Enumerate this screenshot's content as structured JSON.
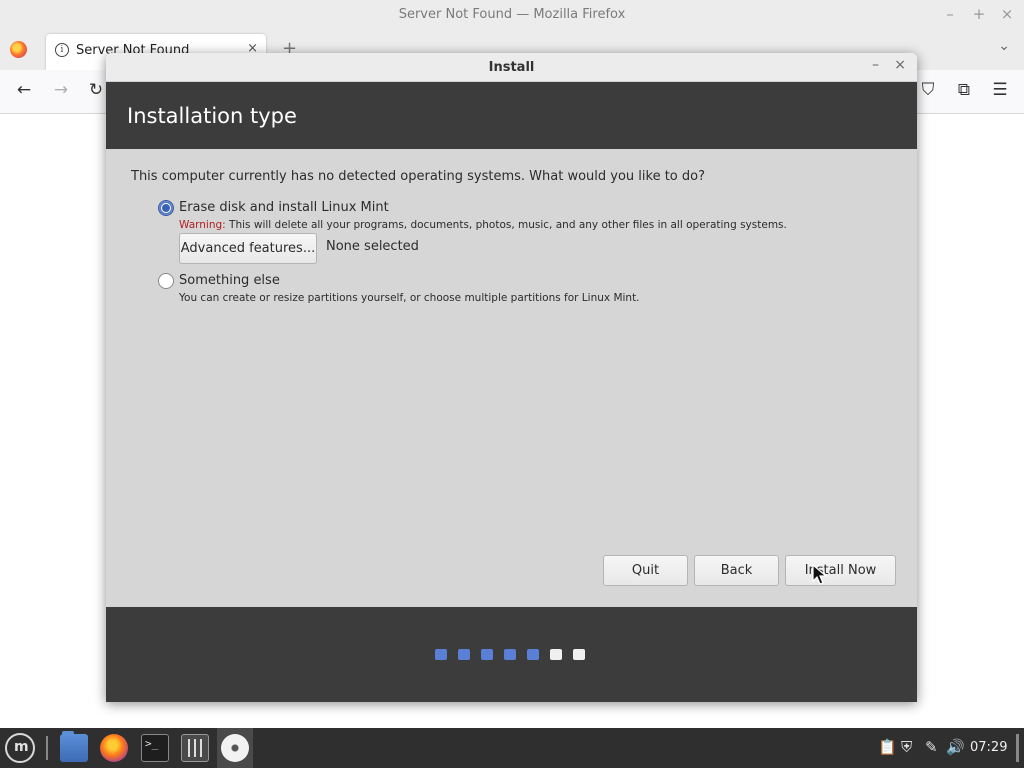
{
  "firefox": {
    "window_title": "Server Not Found — Mozilla Firefox",
    "tab_title": "Server Not Found",
    "win_minimize": "–",
    "win_maximize": "+",
    "win_close": "×",
    "tab_close": "×",
    "new_tab": "+",
    "tab_list": "⌄",
    "nav_back": "←",
    "nav_forward": "→",
    "nav_reload": "↻",
    "pocket": "⛉",
    "extensions": "⧉",
    "menu": "☰"
  },
  "dialog": {
    "title": "Install",
    "minimize": "–",
    "close": "×",
    "heading": "Installation type",
    "question": "This computer currently has no detected operating systems. What would you like to do?",
    "options": [
      {
        "label": "Erase disk and install Linux Mint",
        "checked": true,
        "warning_label": "Warning:",
        "description": " This will delete all your programs, documents, photos, music, and any other files in all operating systems."
      },
      {
        "label": "Something else",
        "checked": false,
        "description": "You can create or resize partitions yourself, or choose multiple partitions for Linux Mint."
      }
    ],
    "advanced_button": "Advanced features...",
    "advanced_status": "None selected",
    "buttons": {
      "quit": "Quit",
      "back": "Back",
      "install_now": "Install Now"
    },
    "progress": {
      "steps_done": 5,
      "steps_total": 7,
      "done_color": "#5a7fd6",
      "todo_color": "#f0f0f0"
    }
  },
  "taskbar": {
    "menu_icon_label": "m",
    "terminal_glyph": ">_",
    "tray": {
      "clipboard": "📋",
      "shield": "⛨",
      "network": "✎",
      "volume": "🔊"
    },
    "clock": "07:29"
  }
}
